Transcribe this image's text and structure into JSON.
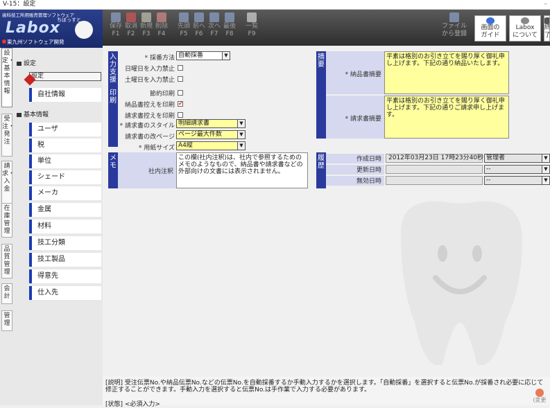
{
  "window": {
    "title": "V-15：設定",
    "minimize": "–"
  },
  "logo": {
    "company_line": "歯科技工所用販売管理ソフトウェア",
    "nickname": "ちぼっすと",
    "brand": "Labox",
    "vendor": "東九州ソフトウェア開発"
  },
  "vtabs": [
    {
      "label": "設定・基本情報"
    },
    {
      "label": "受注・発注"
    },
    {
      "label": "請求・入金"
    },
    {
      "label": "在庫管理"
    },
    {
      "label": "品質管理"
    },
    {
      "label": "会計"
    },
    {
      "label": "管理"
    }
  ],
  "sidebar": {
    "section1": "設定",
    "section2": "基本情報",
    "items1": [
      {
        "label": "設定"
      },
      {
        "label": "自社情報"
      }
    ],
    "items2": [
      {
        "label": "ユーザ"
      },
      {
        "label": "税"
      },
      {
        "label": "単位"
      },
      {
        "label": "シェード"
      },
      {
        "label": "メーカ"
      },
      {
        "label": "金属"
      },
      {
        "label": "材料"
      },
      {
        "label": "技工分類"
      },
      {
        "label": "技工製品"
      },
      {
        "label": "得意先"
      },
      {
        "label": "仕入先"
      }
    ]
  },
  "toolbar": {
    "buttons": [
      {
        "label": "保存",
        "fkey": "F1"
      },
      {
        "label": "取消",
        "fkey": "F2"
      },
      {
        "label": "新規",
        "fkey": "F3"
      },
      {
        "label": "削除",
        "fkey": "F4"
      },
      {
        "label": "先頭",
        "fkey": "F5"
      },
      {
        "label": "前へ",
        "fkey": "F6"
      },
      {
        "label": "次へ",
        "fkey": "F7"
      },
      {
        "label": "最後",
        "fkey": "F8"
      },
      {
        "label": "一覧",
        "fkey": "F9"
      }
    ],
    "right": {
      "register_l1": "ファイル",
      "register_l2": "から登録",
      "guide_l1": "画面の",
      "guide_l2": "ガイド",
      "about_l1": "Labox",
      "about_l2": "について",
      "exit_l1": "終",
      "exit_l2": "了"
    }
  },
  "form": {
    "input_support": {
      "group": "入力支援",
      "numbering_label": "* 採番方法",
      "numbering_value": "自動採番",
      "sunday_label": "日曜日を入力禁止",
      "saturday_label": "土曜日を入力禁止"
    },
    "print": {
      "group": "印刷",
      "save_print_label": "節約印刷",
      "delivery_copy_label": "納品書控えを印刷",
      "invoice_copy_label": "請求書控えを印刷",
      "style_label": "* 請求書のスタイル",
      "style_value": "明細請求書",
      "pagebreak_label": "請求書の改ページ",
      "pagebreak_value": "ページ最大件数",
      "papersize_label": "* 用紙サイズ",
      "papersize_value": "A4縦"
    },
    "summary": {
      "group": "摘要",
      "delivery_label": "* 納品書摘要",
      "delivery_text": "平素は格別のお引き立てを賜り厚く御礼申し上げます。下記の通り納品いたします。",
      "invoice_label": "* 請求書摘要",
      "invoice_text": "平素は格別のお引き立てを賜り厚く御礼申し上げます。下記の通りご請求申し上げます。"
    },
    "memo": {
      "group": "メモ",
      "internal_label": "社内注釈",
      "internal_text": "この欄(社内注釈)は、社内で参照するためのメモのようなもので、納品書や請求書などの外部向けの文書には表示されません。"
    },
    "history": {
      "group": "履歴",
      "created_label": "作成日時",
      "created_value": "2012年03月23日 17時23分40秒",
      "created_by": "管理者",
      "updated_label": "更新日時",
      "updated_by": "--",
      "invalid_label": "無効日時",
      "invalid_by": "--"
    },
    "checks": {
      "sunday": "",
      "saturday": "",
      "save_print": "",
      "delivery_copy": "✔",
      "invoice_copy": ""
    }
  },
  "status": {
    "line1": "[説明] 受注伝票No.や納品伝票No.などの伝票No.を自動採番するか手動入力するかを選択します。「自動採番」を選択すると伝票No.が採番され必要に応じて修正することができます。手動入力を選択すると伝票No.は手作業で入力する必要があります。",
    "line2": "[状態] <必須入力>",
    "help": "(変更"
  }
}
